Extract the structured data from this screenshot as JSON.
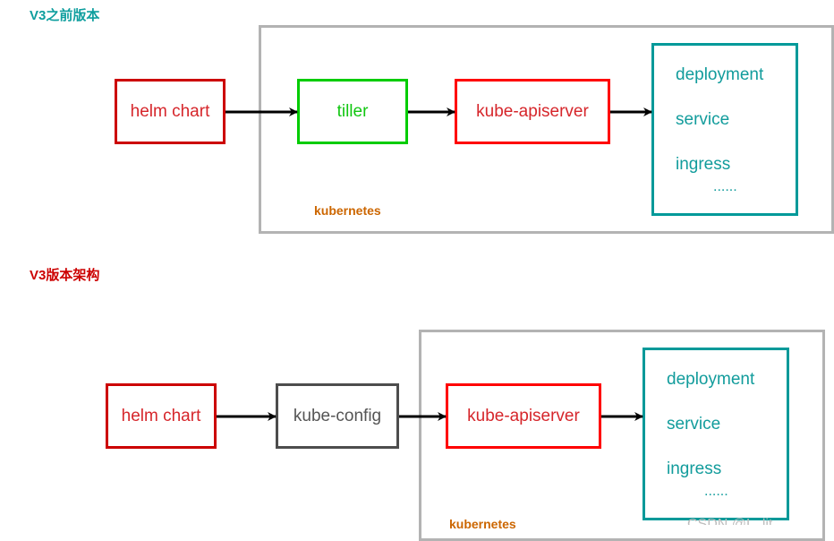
{
  "colors": {
    "title_before": "#0e9e9e",
    "title_v3": "#cc0000",
    "helm_border": "#cc0000",
    "helm_text": "#d6262b",
    "tiller": "#00cc00",
    "apiserver_border": "#ff0000",
    "apiserver_text": "#d6262b",
    "kubeconfig_border": "#4d4d4d",
    "kubeconfig_text": "#555555",
    "resources": "#009999",
    "kubernetes_label": "#cc6600",
    "cluster_border": "#b3b3b3"
  },
  "before_v3": {
    "title": "V3之前版本",
    "cluster_label": "kubernetes",
    "nodes": {
      "helm_chart": "helm chart",
      "tiller": "tiller",
      "apiserver": "kube-apiserver"
    },
    "resources": {
      "items": [
        "deployment",
        "service",
        "ingress"
      ],
      "more": "......"
    }
  },
  "v3": {
    "title": "V3版本架构",
    "cluster_label": "kubernetes",
    "nodes": {
      "helm_chart": "helm chart",
      "kube_config": "kube-config",
      "apiserver": "kube-apiserver"
    },
    "resources": {
      "items": [
        "deployment",
        "service",
        "ingress"
      ],
      "more": "......"
    }
  },
  "watermark": "CSDN @L_lit"
}
